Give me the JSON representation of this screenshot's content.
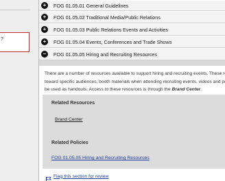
{
  "sidebar": {
    "box_text": "?"
  },
  "accordion": {
    "items": [
      {
        "label": "FOG 01.05.01 General Guidelines",
        "icon": "plus-icon",
        "glyph": "+"
      },
      {
        "label": "FOG 01.05.02 Traditional Media/Public Relations",
        "icon": "plus-icon",
        "glyph": "+"
      },
      {
        "label": "FOG 01.05.03 Public Relations Events and Activities",
        "icon": "plus-icon",
        "glyph": "+"
      },
      {
        "label": "FOG 01.05.04 Events, Conferences and Trade Shows",
        "icon": "plus-icon",
        "glyph": "+"
      },
      {
        "label": "FOG 01.05.05 Hiring and Recruiting Resources",
        "icon": "minus-icon",
        "glyph": "−"
      }
    ]
  },
  "content": {
    "line1": "There are a number of resources available to support hiring and recruiting events. These res",
    "line2": "toward specific audiences, booth materials when attending recruiting events, videos and pr",
    "line3_prefix": "be used as handouts. Access to these resources is through the ",
    "line3_emphasis": "Brand Center",
    "line3_suffix": "."
  },
  "related": {
    "resources_heading": "Related Resources",
    "resources_link": "Brand Center",
    "policies_heading": "Related Policies",
    "policies_link": "FOG 01.05.05 Hiring and Recruiting Resources"
  },
  "flag": {
    "label": "Flag this section for review",
    "icon": "flag-icon"
  },
  "colors": {
    "link_blue": "#1a3a9c",
    "sidebar_box_border": "#c0282d",
    "panel_gray": "#dcdcdc"
  }
}
